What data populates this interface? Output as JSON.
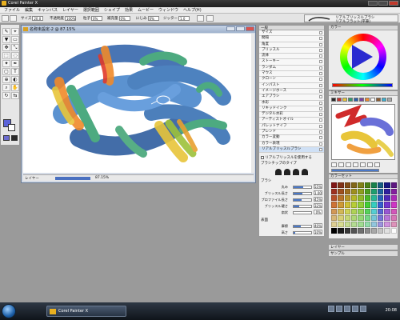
{
  "window": {
    "title": "Corel Painter X"
  },
  "menu": [
    "ファイル",
    "編集",
    "キャンバス",
    "レイヤー",
    "選択範囲",
    "シェイプ",
    "効果",
    "ムービー",
    "ウィンドウ",
    "ヘルプ(H)"
  ],
  "propbar": {
    "size_label": "サイズ",
    "size_value": "20.0",
    "opacity_label": "不透明度",
    "opacity_value": "100%",
    "grain_label": "粒子",
    "grain_value": "0%",
    "resat_label": "補充量",
    "resat_value": "0%",
    "bleed_label": "にじみ",
    "bleed_value": "0%",
    "jitter_label": "ジッター",
    "jitter_value": "1.0",
    "brush_category": "リアルブリッスルブラシ",
    "brush_variant": "リアルフラット(平筆)"
  },
  "document": {
    "title": "名称未設定-2 @ 87.15%",
    "zoom_label": "87.15%",
    "status_label": "レイヤー"
  },
  "brush_panel": {
    "header": "一般",
    "categories": [
      "サイズ",
      "間隔",
      "角度",
      "ブリッスル",
      "流体",
      "ストーキー",
      "ランダム",
      "マウス",
      "クローン",
      "インパスト",
      "イメージホース",
      "エアブラシ",
      "水彩",
      "リキッドインク",
      "デジタル水彩",
      "アーティストオイル",
      "パレットナイフ",
      "ブレンド",
      "カラー変動",
      "カラー表現",
      "リアルブリッスルブラシ"
    ],
    "selected": "リアルブリッスルブラシ",
    "enable_option": "リアルブリッスルを使用する",
    "tip_type_label": "ブラシチップのタイプ",
    "brush_group_label": "ブラシ",
    "sliders": [
      {
        "label": "丸み",
        "value": "55%",
        "fill": 0.55
      },
      {
        "label": "ブリッスル長さ",
        "value": "1.00",
        "fill": 0.5
      },
      {
        "label": "プロファイル長さ",
        "value": "45%",
        "fill": 0.45
      },
      {
        "label": "ブリッスル硬さ",
        "value": "32%",
        "fill": 0.32
      },
      {
        "label": "扇状",
        "value": "0%",
        "fill": 0.0
      }
    ],
    "surface_group_label": "表面",
    "surface_sliders": [
      {
        "label": "摩擦",
        "value": "40%",
        "fill": 0.4
      },
      {
        "label": "高さ",
        "value": "10%",
        "fill": 0.1
      }
    ]
  },
  "color_panel": {
    "header": "カラー"
  },
  "mixer_panel": {
    "header": "ミキサー"
  },
  "color_set_panel": {
    "header": "カラーセット"
  },
  "layers_panel": {
    "header": "レイヤー"
  },
  "sample_panel": {
    "header": "サンプル"
  },
  "taskbar": {
    "task_label": "Corel Painter X",
    "clock": "20:08"
  },
  "colors": {
    "accent": "#4a78c8",
    "main_color": "#5a62d8",
    "stroke_blue": "#2a5ea8",
    "stroke_green": "#2f9c6a",
    "stroke_yellow": "#e8c53a",
    "stroke_orange": "#f08a2a"
  }
}
